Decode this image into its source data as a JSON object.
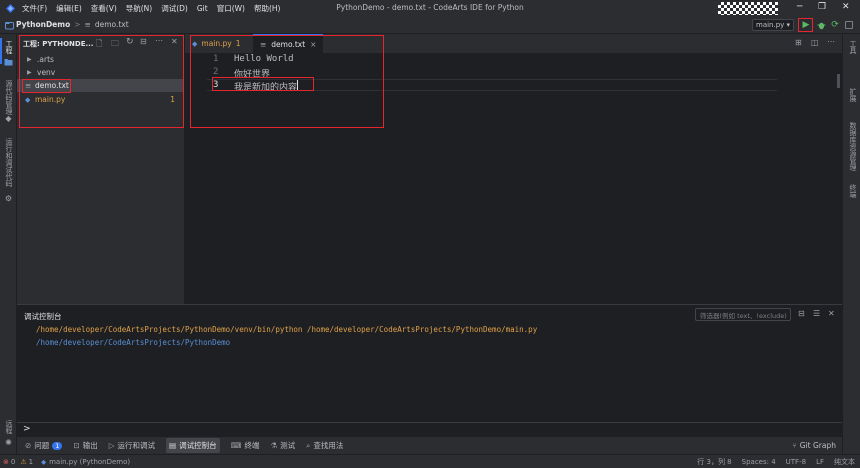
{
  "window": {
    "title": "PythonDemo - demo.txt - CodeArts IDE for Python",
    "menu": [
      "文件(F)",
      "编辑(E)",
      "查看(V)",
      "导航(N)",
      "调试(D)",
      "Git",
      "窗口(W)",
      "帮助(H)"
    ]
  },
  "breadcrumb": {
    "project": "PythonDemo",
    "sep": ">",
    "file": "demo.txt"
  },
  "run_config": {
    "selected": "main.py"
  },
  "left_strip": {
    "project_label": "工程",
    "vcs_label": "源代码管理",
    "debug_label": "运行和调试代码",
    "bottom_label": "远程"
  },
  "right_strip": {
    "labels": [
      "工具",
      "扩展",
      "数据库资源管理",
      "终端"
    ]
  },
  "explorer": {
    "title": "工程: PYTHONDE...",
    "items": [
      {
        "label": ".arts",
        "kind": "folder"
      },
      {
        "label": "venv",
        "kind": "folder"
      },
      {
        "label": "demo.txt",
        "kind": "text",
        "selected": true
      },
      {
        "label": "main.py",
        "kind": "python",
        "badge": "1"
      }
    ]
  },
  "editor": {
    "tabs": [
      {
        "label": "main.py",
        "badge": "1",
        "active": false
      },
      {
        "label": "demo.txt",
        "close": "×",
        "active": true
      }
    ],
    "lines": [
      {
        "num": "1",
        "text": "Hello World"
      },
      {
        "num": "2",
        "text": "你好世界"
      },
      {
        "num": "3",
        "text": "我是新加的内容"
      }
    ]
  },
  "console": {
    "title": "调试控制台",
    "filter_placeholder": "筛选器(例如 text、!exclude)",
    "lines": [
      {
        "text": "/home/developer/CodeArtsProjects/PythonDemo/venv/bin/python /home/developer/CodeArtsProjects/PythonDemo/main.py",
        "color": "#e0a24a"
      },
      {
        "text": "/home/developer/CodeArtsProjects/PythonDemo",
        "color": "#5a8fd6"
      }
    ],
    "prompt": ">"
  },
  "bottom_tabs": [
    {
      "label": "问题",
      "badge": "1",
      "icon": "warning-icon"
    },
    {
      "label": "输出",
      "icon": "output-icon"
    },
    {
      "label": "运行和调试",
      "icon": "run-debug-icon"
    },
    {
      "label": "调试控制台",
      "icon": "debug-console-icon",
      "active": true
    },
    {
      "label": "终端",
      "icon": "terminal-icon"
    },
    {
      "label": "测试",
      "icon": "test-icon"
    },
    {
      "label": "查找用法",
      "icon": "find-usages-icon"
    }
  ],
  "git_graph": {
    "label": "Git Graph"
  },
  "status": {
    "errors": "0",
    "warnings": "1",
    "file": "main.py (PythonDemo)",
    "position": "行 3，列 8",
    "spaces": "Spaces: 4",
    "encoding": "UTF-8",
    "eol": "LF",
    "language": "纯文本"
  },
  "colors": {
    "accent": "#3574f0",
    "highlight_box": "#e5262f",
    "python_file": "#e0a24a",
    "run_green": "#5fb865"
  }
}
